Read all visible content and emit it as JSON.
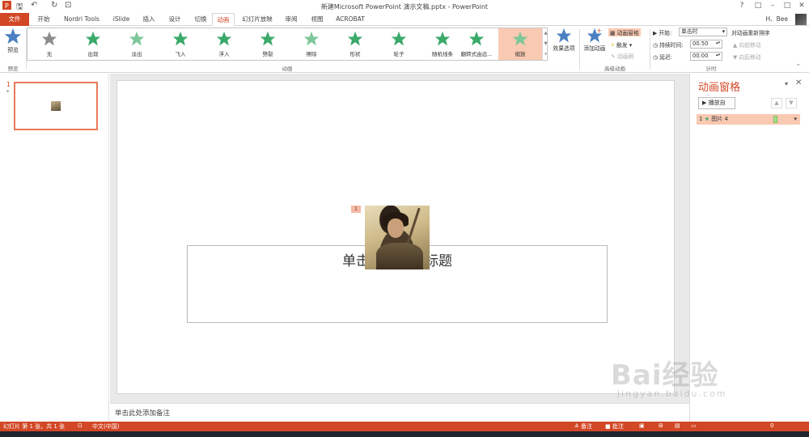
{
  "window": {
    "title": "新建Microsoft PowerPoint 演示文稿.pptx - PowerPoint",
    "user": "H、Bee",
    "controls": [
      "?",
      "□",
      "–",
      "□",
      "✕"
    ]
  },
  "tabs": [
    {
      "label": "文件",
      "kind": "file"
    },
    {
      "label": "开始"
    },
    {
      "label": "Nordri Tools"
    },
    {
      "label": "iSlide"
    },
    {
      "label": "插入"
    },
    {
      "label": "设计"
    },
    {
      "label": "切换"
    },
    {
      "label": "动画",
      "kind": "active"
    },
    {
      "label": "幻灯片放映"
    },
    {
      "label": "审阅"
    },
    {
      "label": "视图"
    },
    {
      "label": "ACROBAT"
    }
  ],
  "ribbon": {
    "preview": {
      "label": "预览",
      "group": "预览"
    },
    "animations": [
      {
        "label": "无",
        "color": "#8c8c8c"
      },
      {
        "label": "出现",
        "color": "#3aa96a"
      },
      {
        "label": "淡出",
        "color": "#7ec79a"
      },
      {
        "label": "飞入",
        "color": "#3aa96a"
      },
      {
        "label": "浮入",
        "color": "#3aa96a"
      },
      {
        "label": "劈裂",
        "color": "#3aa96a"
      },
      {
        "label": "擦除",
        "color": "#7ec79a"
      },
      {
        "label": "形状",
        "color": "#3aa96a"
      },
      {
        "label": "轮子",
        "color": "#3aa96a"
      },
      {
        "label": "随机线条",
        "color": "#3aa96a"
      },
      {
        "label": "翻转式由远...",
        "color": "#3aa96a"
      },
      {
        "label": "缩放",
        "color": "#7ec79a",
        "selected": true
      }
    ],
    "group_animation": "动画",
    "effect_options": "效果选项",
    "add_animation": "添加动画",
    "animation_pane_btn": "动画窗格",
    "trigger": "触发 ▾",
    "painter": "动画刷",
    "group_advanced": "高级动画",
    "start_label": "开始:",
    "start_value": "单击时",
    "duration_label": "持续时间:",
    "duration_value": "00.50",
    "delay_label": "延迟:",
    "delay_value": "00.00",
    "reorder_title": "对动画重新排序",
    "move_earlier": "▲ 向前移动",
    "move_later": "▼ 向后移动",
    "group_timing": "计时"
  },
  "thumbnails": [
    {
      "number": "1",
      "star": "*"
    }
  ],
  "slide": {
    "title_placeholder": "单击此处添加标题",
    "badge": "1"
  },
  "notes": {
    "placeholder": "单击此处添加备注"
  },
  "anim_pane": {
    "title": "动画窗格",
    "play_btn": "▶ 播放自",
    "up": "▲",
    "down": "▼",
    "items": [
      {
        "index": "1",
        "name": "图片 4"
      }
    ]
  },
  "status": {
    "slide_info": "幻灯片 第 1 张，共 1 张",
    "language": "中文(中国)",
    "notes": "≙ 备注",
    "comments": "■ 批注",
    "zoom": "0"
  },
  "watermark": {
    "brand": "Bai经验",
    "url": "jingyan.baidu.com"
  }
}
